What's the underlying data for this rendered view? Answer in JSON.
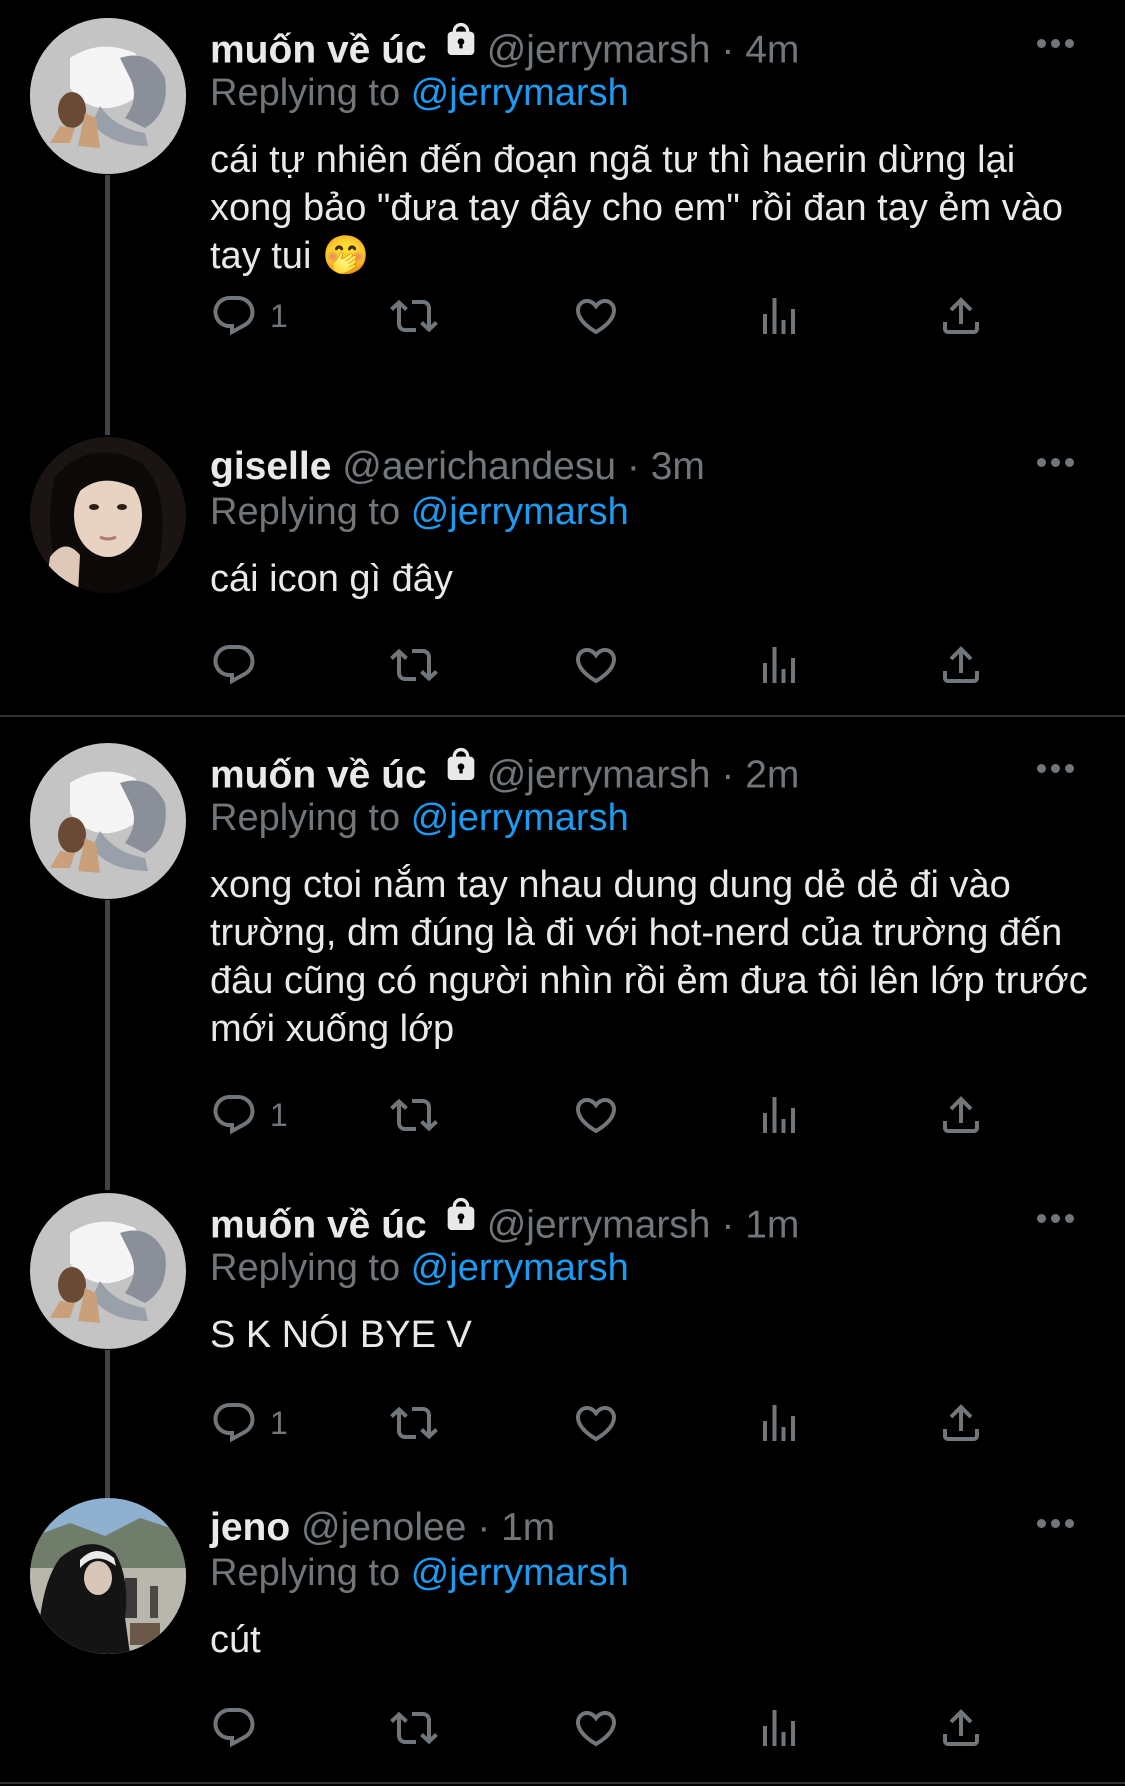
{
  "tweets": [
    {
      "name": "muốn về úc",
      "protected": true,
      "handle": "@jerrymarsh",
      "dot": "·",
      "time": "4m",
      "replying_label": "Replying to",
      "replying_to": "@jerrymarsh",
      "text": "cái tự nhiên đến đoạn ngã tư thì haerin dừng lại xong bảo \"đưa tay đây cho em\" rồi đan tay ẻm vào tay tui 🤭",
      "reply_count": "1",
      "avatar": "kneeling-figure"
    },
    {
      "name": "giselle",
      "protected": false,
      "handle": "@aerichandesu",
      "dot": "·",
      "time": "3m",
      "replying_label": "Replying to",
      "replying_to": "@jerrymarsh",
      "text": "cái icon gì đây",
      "reply_count": "",
      "avatar": "girl-photo"
    },
    {
      "name": "muốn về úc",
      "protected": true,
      "handle": "@jerrymarsh",
      "dot": "·",
      "time": "2m",
      "replying_label": "Replying to",
      "replying_to": "@jerrymarsh",
      "text": "xong ctoi nắm tay nhau dung dung dẻ dẻ đi vào trường, dm đúng là đi với hot-nerd của trường đến đâu cũng có người nhìn rồi ẻm đưa tôi lên lớp trước mới xuống lớp",
      "reply_count": "1",
      "avatar": "kneeling-figure"
    },
    {
      "name": "muốn về úc",
      "protected": true,
      "handle": "@jerrymarsh",
      "dot": "·",
      "time": "1m",
      "replying_label": "Replying to",
      "replying_to": "@jerrymarsh",
      "text": "S K NÓI BYE V",
      "reply_count": "1",
      "avatar": "kneeling-figure"
    },
    {
      "name": "jeno",
      "protected": false,
      "handle": "@jenolee",
      "dot": "·",
      "time": "1m",
      "replying_label": "Replying to",
      "replying_to": "@jerrymarsh",
      "text": "cút",
      "reply_count": "",
      "avatar": "hoodie-photo"
    }
  ],
  "colors": {
    "background": "#000000",
    "text": "#e7e9ea",
    "secondary": "#71767b",
    "link": "#1d9bf0",
    "line": "#3f4449"
  },
  "icons": [
    "reply-icon",
    "retweet-icon",
    "like-icon",
    "views-icon",
    "share-icon",
    "lock-icon",
    "more-icon"
  ]
}
